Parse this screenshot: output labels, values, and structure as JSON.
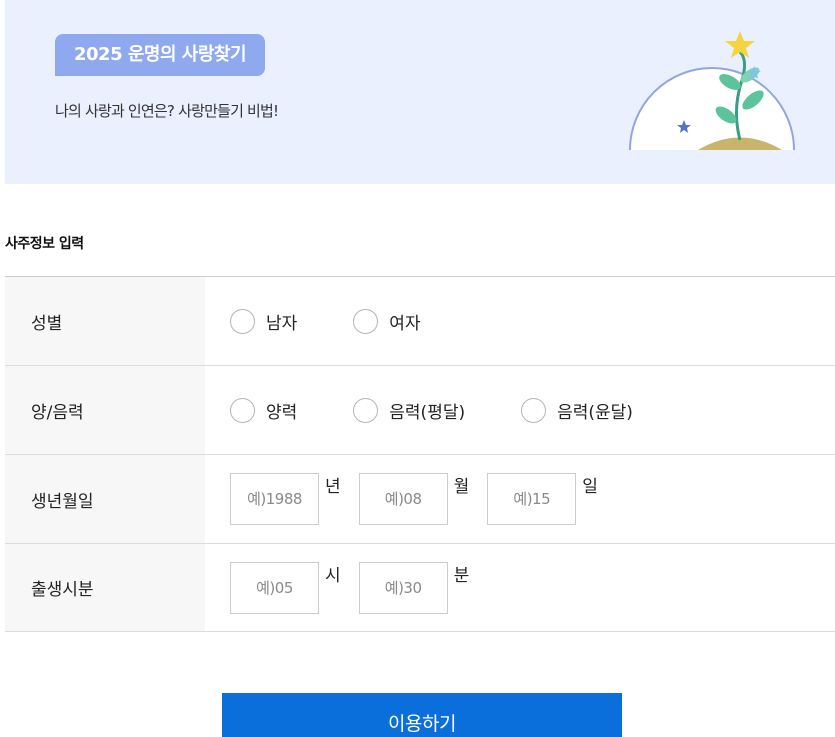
{
  "banner": {
    "badge": "2025 운명의 사랑찾기",
    "subtitle": "나의 사랑과 인연은? 사랑만들기 비법!",
    "colors": {
      "background": "#eaf0fd",
      "badge": "#8ea9ee"
    }
  },
  "section_title": "사주정보 입력",
  "gender": {
    "label": "성별",
    "options": [
      "남자",
      "여자"
    ]
  },
  "calendar": {
    "label": "양/음력",
    "options": [
      "양력",
      "음력(평달)",
      "음력(윤달)"
    ]
  },
  "birthdate": {
    "label": "생년월일",
    "year_placeholder": "예)1988",
    "year_unit": "년",
    "month_placeholder": "예)08",
    "month_unit": "월",
    "day_placeholder": "예)15",
    "day_unit": "일"
  },
  "birthtime": {
    "label": "출생시분",
    "hour_placeholder": "예)05",
    "hour_unit": "시",
    "minute_placeholder": "예)30",
    "minute_unit": "분"
  },
  "submit_label": "이용하기",
  "accent_color": "#0a6fdb"
}
